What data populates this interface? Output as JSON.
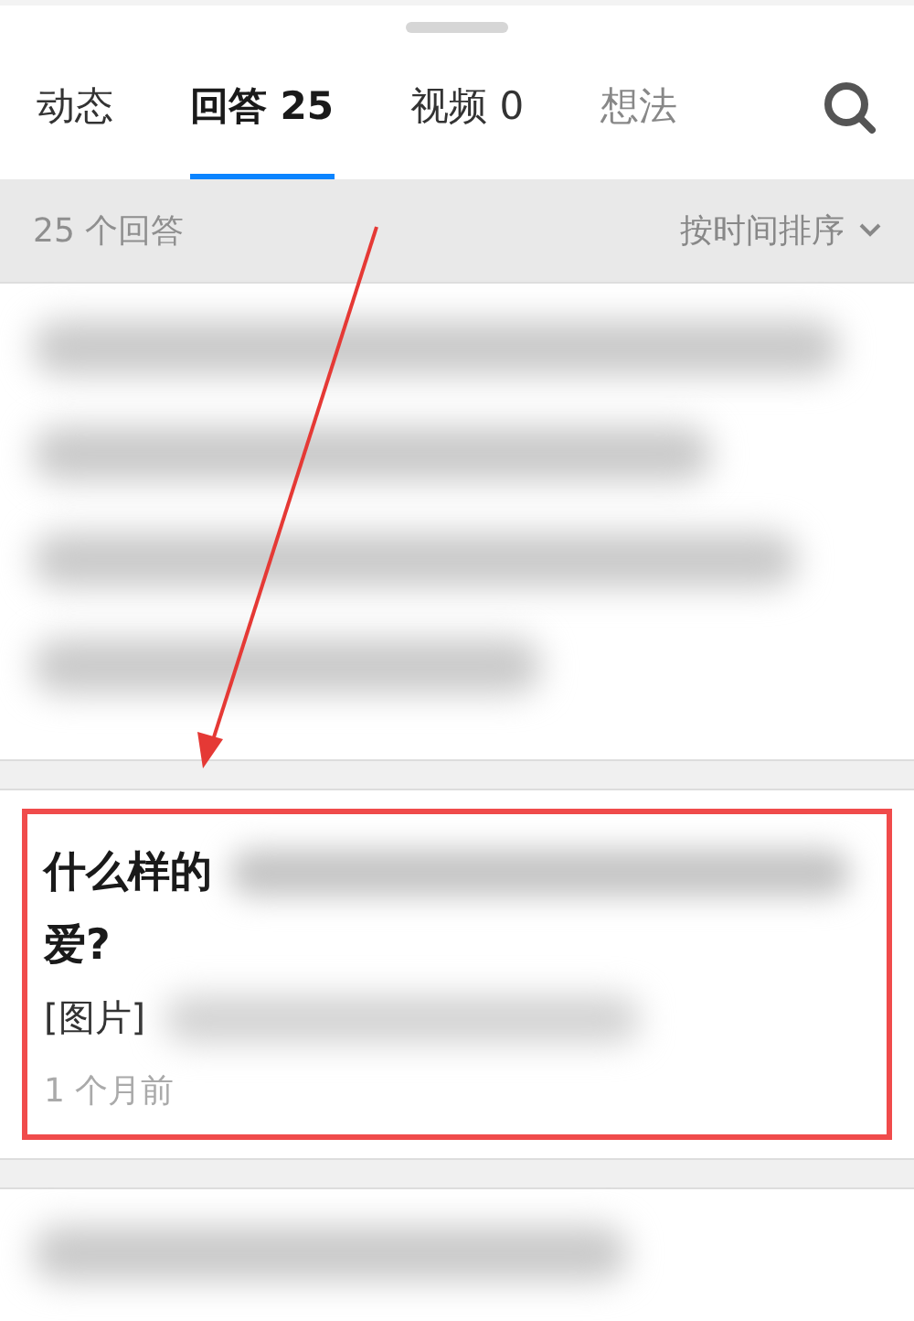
{
  "tabs": [
    {
      "label": "动态",
      "selected": false
    },
    {
      "label": "回答 25",
      "selected": true
    },
    {
      "label": "视频 0",
      "selected": false
    },
    {
      "label": "想法",
      "selected": false,
      "faded": true
    }
  ],
  "filter_bar": {
    "count": "25 个回答",
    "sort": "按时间排序"
  },
  "answers": [
    {
      "kind": "redacted"
    },
    {
      "kind": "answer",
      "highlighted": true,
      "title_start": "什么样的",
      "title_end": "爱?",
      "excerpt": "[图片]",
      "time": "1 个月前"
    },
    {
      "kind": "redacted"
    }
  ]
}
